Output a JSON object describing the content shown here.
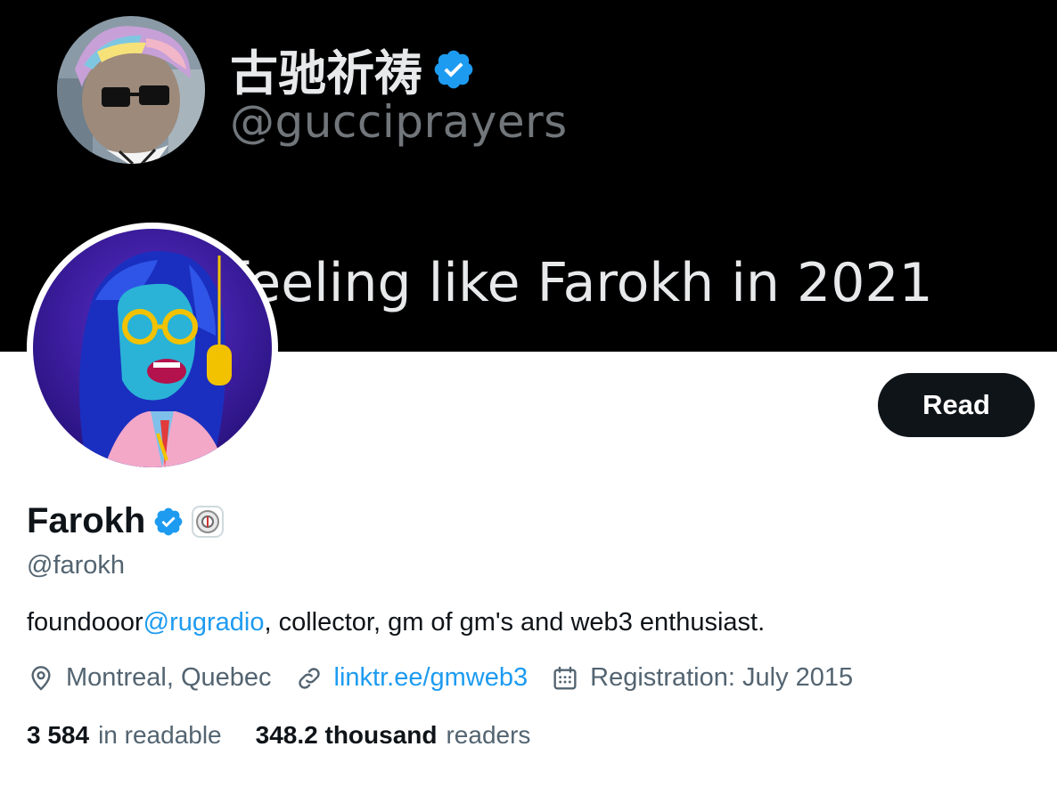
{
  "banner": {
    "name": "古驰祈祷",
    "handle": "@gucciprayers",
    "caption": "p feeling like Farokh in 2021"
  },
  "profile": {
    "name": "Farokh",
    "handle": "@farokh",
    "bio_prefix": "foundooor",
    "bio_mention": "@rugradio",
    "bio_suffix": ", collector, gm of gm's and web3 enthusiast.",
    "location": "Montreal, Quebec",
    "link": "linktr.ee/gmweb3",
    "joined": "Registration: July 2015"
  },
  "actions": {
    "read_label": "Read"
  },
  "stats": {
    "following_count": "3 584",
    "following_label": "in readable",
    "followers_count": "348.2 thousand",
    "followers_label": "readers"
  },
  "colors": {
    "verified_blue": "#1d9bf0",
    "button_bg": "#0f1419",
    "secondary_text": "#536471",
    "banner_bg": "#000000"
  },
  "icons": [
    "verified-badge-icon",
    "affiliate-badge-icon",
    "location-pin-icon",
    "link-icon",
    "calendar-icon"
  ]
}
